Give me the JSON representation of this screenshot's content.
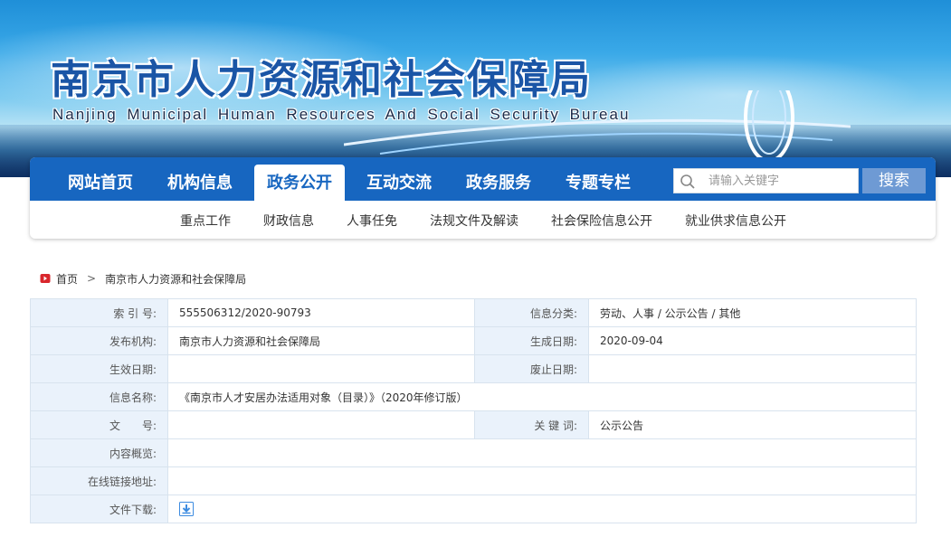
{
  "banner": {
    "title_cn": "南京市人力资源和社会保障局",
    "title_en": "Nanjing Municipal Human Resources And Social Security Bureau"
  },
  "nav": {
    "items": [
      {
        "label": "网站首页",
        "active": false
      },
      {
        "label": "机构信息",
        "active": false
      },
      {
        "label": "政务公开",
        "active": true
      },
      {
        "label": "互动交流",
        "active": false
      },
      {
        "label": "政务服务",
        "active": false
      },
      {
        "label": "专题专栏",
        "active": false
      }
    ],
    "search_placeholder": "请输入关键字",
    "search_label": "搜索"
  },
  "subnav": {
    "items": [
      "重点工作",
      "财政信息",
      "人事任免",
      "法规文件及解读",
      "社会保险信息公开",
      "就业供求信息公开"
    ]
  },
  "breadcrumb": {
    "home": "首页",
    "current": "南京市人力资源和社会保障局"
  },
  "info": {
    "index_label": "索 引 号:",
    "index_value": "555506312/2020-90793",
    "category_label": "信息分类:",
    "category_value": "劳动、人事 / 公示公告 / 其他",
    "publisher_label": "发布机构:",
    "publisher_value": "南京市人力资源和社会保障局",
    "created_label": "生成日期:",
    "created_value": "2020-09-04",
    "effective_label": "生效日期:",
    "effective_value": "",
    "expire_label": "废止日期:",
    "expire_value": "",
    "name_label": "信息名称:",
    "name_value": "《南京市人才安居办法适用对象（目录）》（2020年修订版）",
    "doc_no_label": "文　　号:",
    "doc_no_value": "",
    "keywords_label": "关 键 词:",
    "keywords_value": "公示公告",
    "overview_label": "内容概览:",
    "overview_value": "",
    "link_label": "在线链接地址:",
    "link_value": "",
    "download_label": "文件下载:"
  },
  "colors": {
    "nav_blue": "#1766c0",
    "label_bg": "#eaf2fb",
    "search_button": "#6e9ad4",
    "breadcrumb_icon": "#d9262c"
  }
}
